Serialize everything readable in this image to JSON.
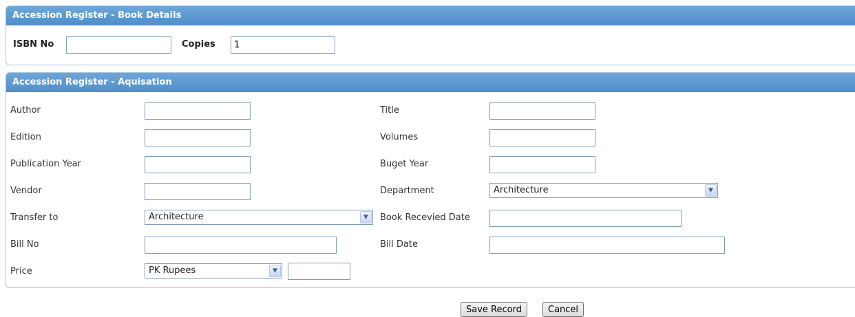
{
  "book_details": {
    "header": "Accession Register - Book Details",
    "isbn_label": "ISBN No",
    "isbn_value": "",
    "copies_label": "Copies",
    "copies_value": "1"
  },
  "acquisition": {
    "header": "Accession Register - Aquisation",
    "author_label": "Author",
    "title_label": "Title",
    "edition_label": "Edition",
    "volumes_label": "Volumes",
    "publication_year_label": "Publication Year",
    "budget_year_label": "Buget Year",
    "vendor_label": "Vendor",
    "department_label": "Department",
    "department_value": "Architecture",
    "transfer_to_label": "Transfer to",
    "transfer_to_value": "Architecture",
    "book_received_date_label": "Book Recevied Date",
    "bill_no_label": "Bill No",
    "bill_date_label": "Bill Date",
    "price_label": "Price",
    "currency_value": "PK Rupees"
  },
  "actions": {
    "save_label": "Save Record",
    "cancel_label": "Cancel"
  },
  "icons": {
    "dropdown": "chevron-down-icon"
  }
}
